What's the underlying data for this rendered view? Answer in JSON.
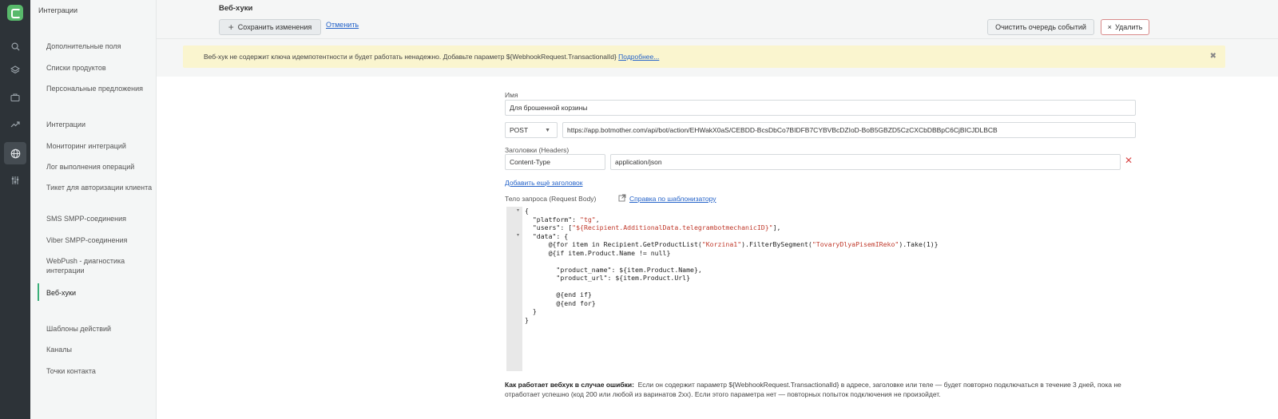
{
  "sidebar": {
    "title": "Интеграции",
    "items": [
      {
        "label": "Дополнительные поля"
      },
      {
        "label": "Списки продуктов"
      },
      {
        "label": "Персональные предложения"
      },
      {
        "label": "Интеграции"
      },
      {
        "label": "Мониторинг интеграций"
      },
      {
        "label": "Лог выполнения операций"
      },
      {
        "label": "Тикет для авторизации клиента"
      },
      {
        "label": "SMS SMPP-соединения"
      },
      {
        "label": "Viber SMPP-соединения"
      },
      {
        "label": "WebPush - диагностика интеграции"
      },
      {
        "label": "Веб-хуки"
      },
      {
        "label": "Шаблоны действий"
      },
      {
        "label": "Каналы"
      },
      {
        "label": "Точки контакта"
      }
    ]
  },
  "rail": {
    "icons": [
      "search-icon",
      "layers-icon",
      "briefcase-icon",
      "trend-icon",
      "globe-icon",
      "sliders-icon"
    ]
  },
  "header": {
    "title": "Веб-хуки",
    "save_label": "Сохранить изменения",
    "cancel_label": "Отменить",
    "clear_queue_label": "Очистить очередь событий",
    "delete_label": "Удалить"
  },
  "warning": {
    "text": "Веб-хук не содержит ключа идемпотентности и будет работать ненадежно. Добавьте параметр ${WebhookRequest.TransactionalId}",
    "link": "Подробнее..."
  },
  "form": {
    "name_label": "Имя",
    "name_value": "Для брошенной корзины",
    "method_value": "POST",
    "url_value": "https://app.botmother.com/api/bot/action/EHWakX0aS/CEBDD-BcsDbCo7BIDFB7CYBVBcDZIoD-BoB5GBZD5CzCXCbDBBpC6CjBICJDLBCB",
    "headers_label": "Заголовки (Headers)",
    "header_key": "Content-Type",
    "header_value": "application/json",
    "add_header_label": "Добавить ещё заголовок",
    "body_label": "Тело запроса (Request Body)",
    "help_link": "Справка по шаблонизатору"
  },
  "code": {
    "l1": "{",
    "l2a": "  \"platform\": ",
    "l2b": "\"tg\"",
    "l2c": ",",
    "l3a": "  \"users\": [",
    "l3b": "\"${Recipient.AdditionalData.telegrambotmechanicID}\"",
    "l3c": "],",
    "l4": "  \"data\": {",
    "l5a": "      @{for item in Recipient.GetProductList(",
    "l5b": "\"Korzina1\"",
    "l5c": ").FilterBySegment(",
    "l5d": "\"TovaryDlyaPisemIReko\"",
    "l5e": ").Take(1)}",
    "l6": "      @{if item.Product.Name != null}",
    "l7": "",
    "l8": "        \"product_name\": ${item.Product.Name},",
    "l9": "        \"product_url\": ${item.Product.Url}",
    "l10": "",
    "l11": "        @{end if}",
    "l12": "        @{end for}",
    "l13": "  }",
    "l14": "}"
  },
  "note": {
    "bold": "Как работает вебхук в случае ошибки:",
    "text": "Если он содержит параметр ${WebhookRequest.TransactionalId} в адресе, заголовке или теле — будет повторно подключаться в течение 3 дней, пока не отработает успешно (код 200 или любой из варинатов 2xx). Если этого параметра нет — повторных попыток подключения не произойдет."
  }
}
